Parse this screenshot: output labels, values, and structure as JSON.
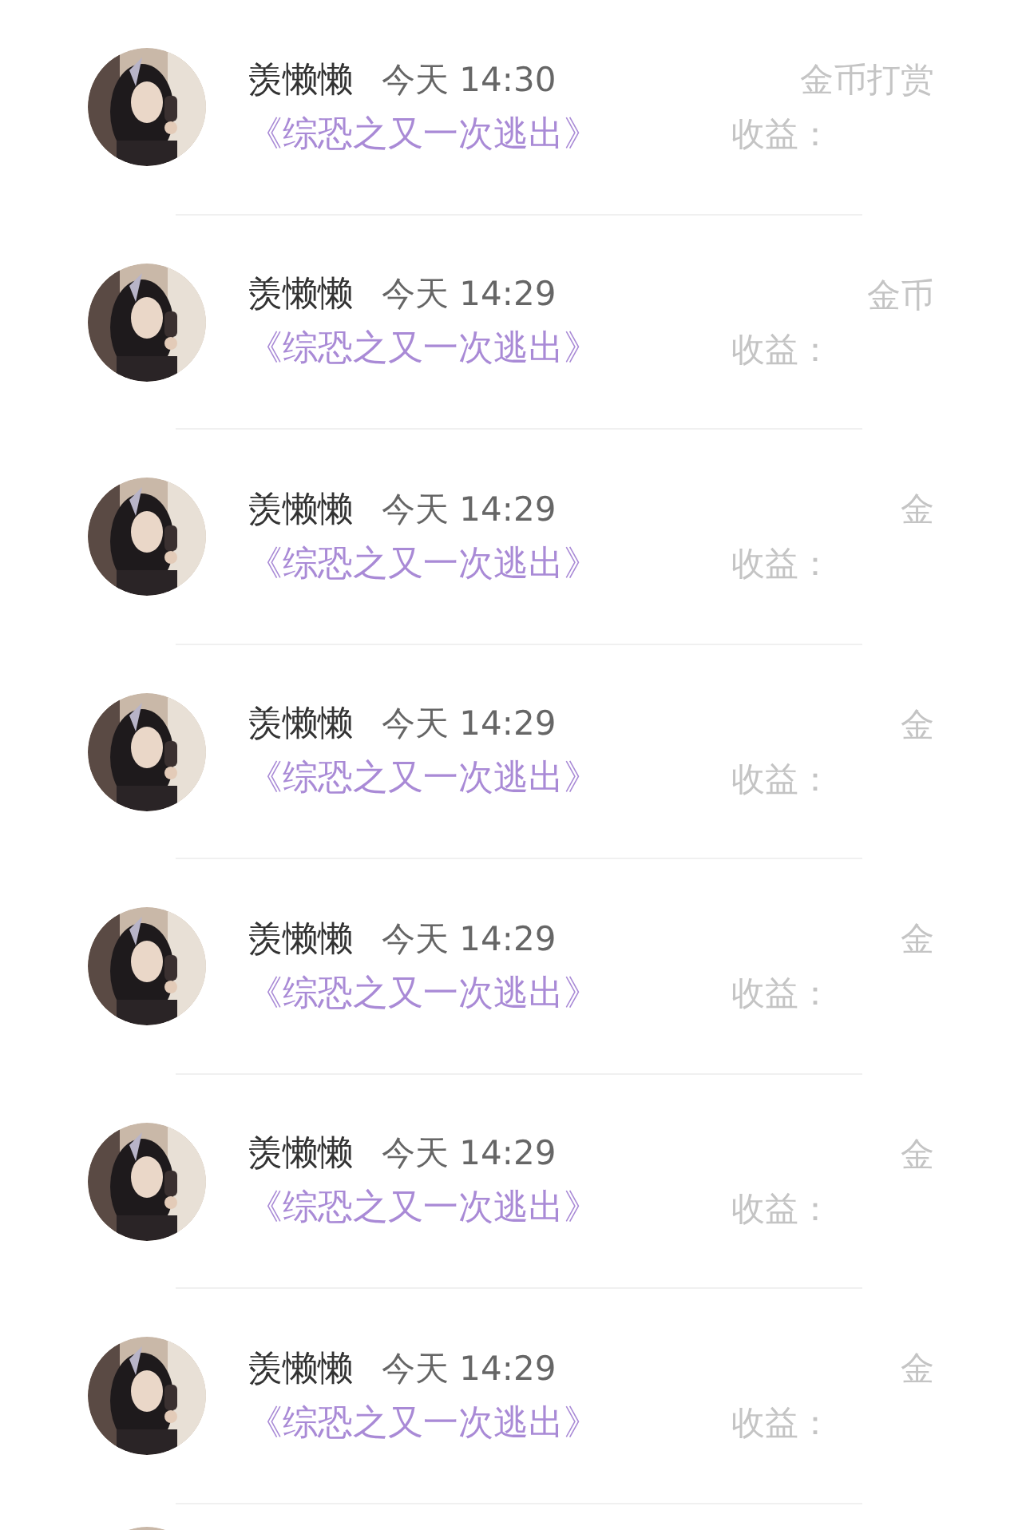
{
  "records": [
    {
      "kind": "full",
      "name": "羡懒懒",
      "time": "今天 14:30",
      "title": "《综恐之又一次逃出》",
      "type_label": "金币打赏",
      "earnings_label": "收益："
    },
    {
      "kind": "full",
      "name": "羡懒懒",
      "time": "今天 14:29",
      "title": "《综恐之又一次逃出》",
      "type_label": "金币",
      "earnings_label": "收益："
    },
    {
      "kind": "full",
      "name": "羡懒懒",
      "time": "今天 14:29",
      "title": "《综恐之又一次逃出》",
      "type_label": "金",
      "earnings_label": "收益："
    },
    {
      "kind": "full",
      "name": "羡懒懒",
      "time": "今天 14:29",
      "title": "《综恐之又一次逃出》",
      "type_label": "金",
      "earnings_label": "收益："
    },
    {
      "kind": "full",
      "name": "羡懒懒",
      "time": "今天 14:29",
      "title": "《综恐之又一次逃出》",
      "type_label": "金",
      "earnings_label": "收益："
    },
    {
      "kind": "full",
      "name": "羡懒懒",
      "time": "今天 14:29",
      "title": "《综恐之又一次逃出》",
      "type_label": "金",
      "earnings_label": "收益："
    },
    {
      "kind": "full",
      "name": "羡懒懒",
      "time": "今天 14:29",
      "title": "《综恐之又一次逃出》",
      "type_label": "金",
      "earnings_label": "收益："
    },
    {
      "kind": "partial"
    }
  ]
}
